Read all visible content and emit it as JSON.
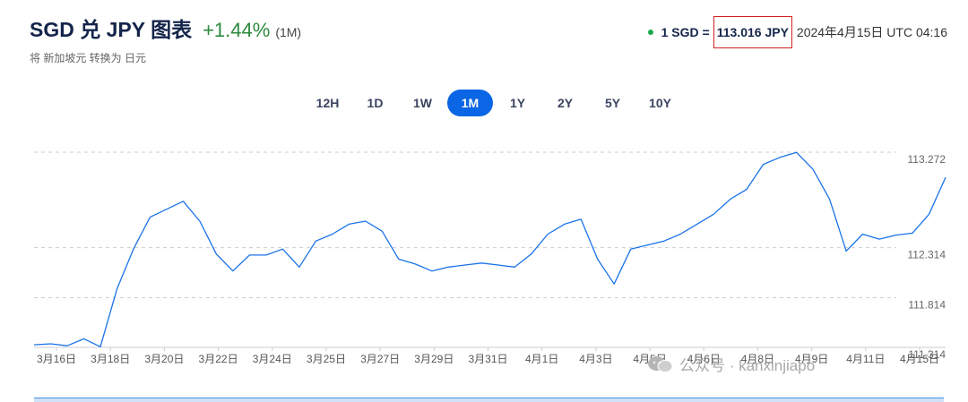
{
  "header": {
    "title": "SGD 兑 JPY 图表",
    "change": "+1.44%",
    "period": "(1M)",
    "subtitle": "将 新加坡元 转换为 日元",
    "rate_label": "1 SGD =",
    "rate_value": "113.016 JPY",
    "rate_time": "2024年4月15日 UTC 04:16"
  },
  "tabs": [
    {
      "label": "12H",
      "active": false
    },
    {
      "label": "1D",
      "active": false
    },
    {
      "label": "1W",
      "active": false
    },
    {
      "label": "1M",
      "active": true
    },
    {
      "label": "1Y",
      "active": false
    },
    {
      "label": "2Y",
      "active": false
    },
    {
      "label": "5Y",
      "active": false
    },
    {
      "label": "10Y",
      "active": false
    }
  ],
  "watermark": "公众号 · kanxinjiapo",
  "colors": {
    "line": "#1a73e8",
    "accent": "#0a66e4",
    "positive": "#2e8a3e",
    "highlight": "#d32020"
  },
  "chart_data": {
    "type": "line",
    "title": "",
    "xlabel": "",
    "ylabel": "",
    "y_ticks": [
      111.314,
      111.814,
      112.314,
      113.272
    ],
    "ylim": [
      111.314,
      113.272
    ],
    "x_ticks": [
      "3月16日",
      "3月18日",
      "3月20日",
      "3月22日",
      "3月24日",
      "3月25日",
      "3月27日",
      "3月29日",
      "3月31日",
      "4月1日",
      "4月3日",
      "4月5日",
      "4月6日",
      "4月8日",
      "4月9日",
      "4月11日",
      "4月15日"
    ],
    "grid": "horizontal-dashed",
    "series": [
      {
        "name": "",
        "points": [
          [
            "3月16日",
            111.34
          ],
          [
            "3月17日",
            111.35
          ],
          [
            "3月17日",
            111.33
          ],
          [
            "3月18日",
            111.4
          ],
          [
            "3月18日",
            111.32
          ],
          [
            "3月19日",
            111.9
          ],
          [
            "3月19日",
            112.3
          ],
          [
            "3月20日",
            112.62
          ],
          [
            "3月20日",
            112.7
          ],
          [
            "3月21日",
            112.78
          ],
          [
            "3月21日",
            112.58
          ],
          [
            "3月22日",
            112.25
          ],
          [
            "3月22日",
            112.08
          ],
          [
            "3月23日",
            112.24
          ],
          [
            "3月24日",
            112.24
          ],
          [
            "3月24日",
            112.3
          ],
          [
            "3月24日",
            112.12
          ],
          [
            "3月25日",
            112.38
          ],
          [
            "3月25日",
            112.45
          ],
          [
            "3月26日",
            112.55
          ],
          [
            "3月26日",
            112.58
          ],
          [
            "3月27日",
            112.48
          ],
          [
            "3月27日",
            112.2
          ],
          [
            "3月28日",
            112.15
          ],
          [
            "3月28日",
            112.08
          ],
          [
            "3月29日",
            112.12
          ],
          [
            "3月30日",
            112.14
          ],
          [
            "3月31日",
            112.16
          ],
          [
            "4月1日",
            112.14
          ],
          [
            "4月2日",
            112.12
          ],
          [
            "4月3日",
            112.25
          ],
          [
            "4月3日",
            112.45
          ],
          [
            "4月4日",
            112.55
          ],
          [
            "4月4日",
            112.6
          ],
          [
            "4月5日",
            112.2
          ],
          [
            "4月5日",
            111.95
          ],
          [
            "4月5日",
            112.3
          ],
          [
            "4月6日",
            112.34
          ],
          [
            "4月7日",
            112.38
          ],
          [
            "4月8日",
            112.45
          ],
          [
            "4月8日",
            112.55
          ],
          [
            "4月9日",
            112.65
          ],
          [
            "4月9日",
            112.8
          ],
          [
            "4月10日",
            112.9
          ],
          [
            "4月11日",
            113.15
          ],
          [
            "4月11日",
            113.22
          ],
          [
            "4月12日",
            113.27
          ],
          [
            "4月12日",
            113.1
          ],
          [
            "4月13日",
            112.8
          ],
          [
            "4月13日",
            112.28
          ],
          [
            "4月13日",
            112.45
          ],
          [
            "4月14日",
            112.4
          ],
          [
            "4月14日",
            112.44
          ],
          [
            "4月15日",
            112.46
          ],
          [
            "4月15日",
            112.65
          ],
          [
            "4月15日",
            113.02
          ]
        ]
      }
    ]
  }
}
